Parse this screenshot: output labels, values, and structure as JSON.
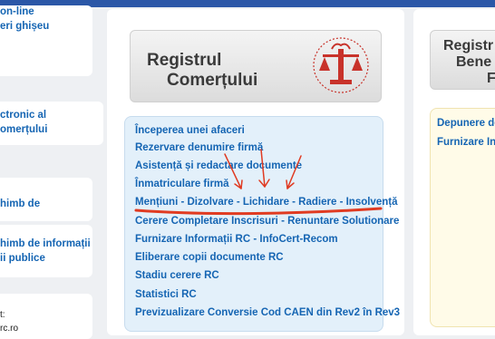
{
  "left_col": {
    "items": [
      {
        "line1": "on-line",
        "line2": "eri ghișeu"
      },
      {
        "line1": "ctronic al",
        "line2": "omerțului"
      },
      {
        "line1": "himb de",
        "line2": ""
      },
      {
        "line1": "himb de informații",
        "line2": "ii publice"
      }
    ],
    "footer": {
      "line1": "t:",
      "line2": "rc.ro"
    }
  },
  "banner": {
    "title_line1": "Registrul",
    "title_line2": "Comerțului",
    "logo_text": "REGISTRUL COMERȚULUI"
  },
  "menu": {
    "links": [
      "Începerea unei afaceri",
      "Rezervare denumire firmă",
      "Asistență și redactare documente",
      "Înmatriculare firmă",
      "Mențiuni - Dizolvare - Lichidare - Radiere - Insolvență",
      "Cerere Completare Inscrisuri - Renuntare Solutionare",
      "Furnizare Informații RC - InfoCert-Recom",
      "Eliberare copii documente RC",
      "Stadiu cerere RC",
      "Statistici RC",
      "Previzualizare Conversie Cod CAEN din Rev2 în Rev3"
    ]
  },
  "right_col": {
    "banner_line1": "Registr",
    "banner_line2": "Bene",
    "banner_line3": "F",
    "links": [
      "Depunere de",
      "Furnizare Info"
    ]
  },
  "annotation": {
    "color": "#e03b22"
  }
}
